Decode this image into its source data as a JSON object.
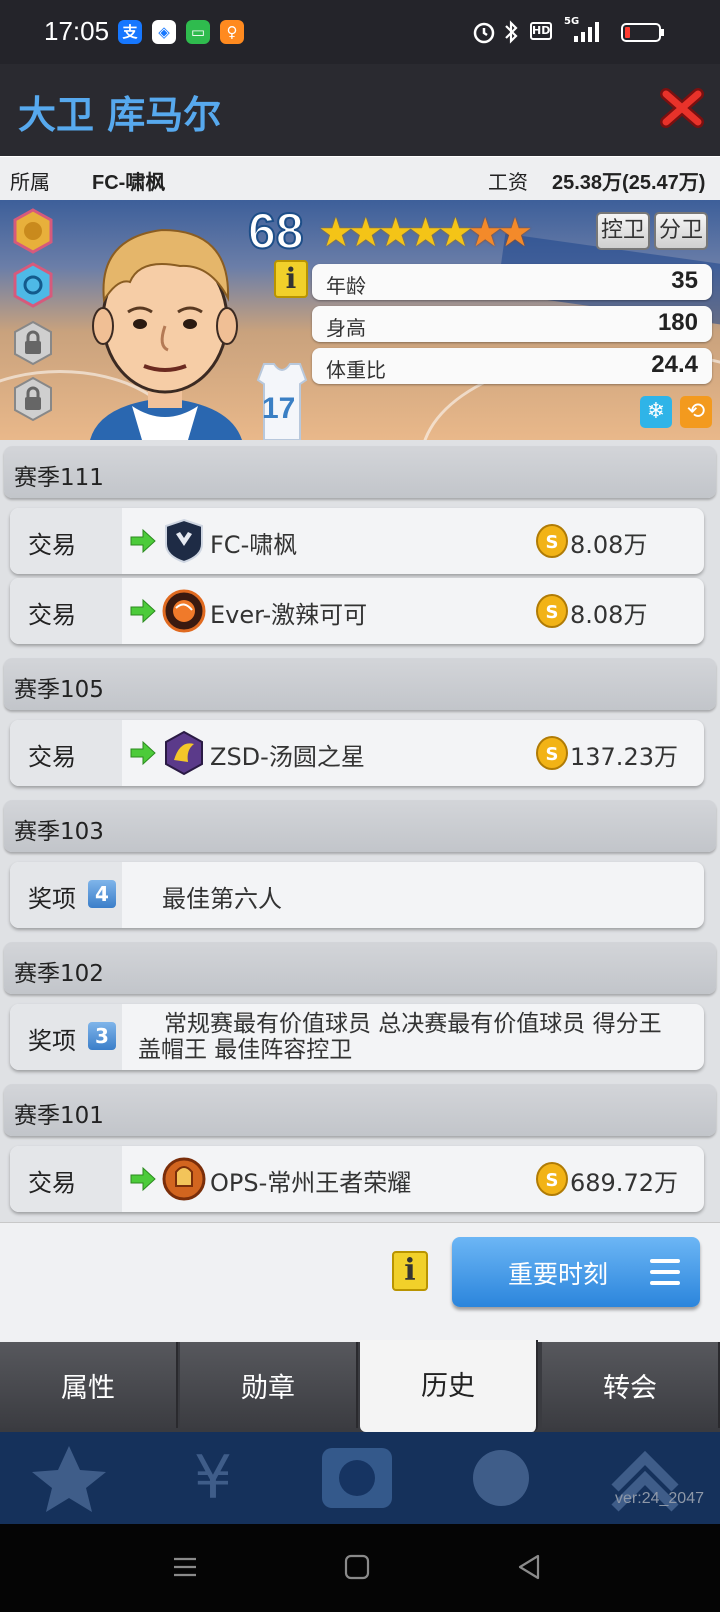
{
  "status_bar": {
    "time": "17:05",
    "apps": [
      "alipay-icon",
      "browser-icon",
      "wechat-icon",
      "ticket-app-icon"
    ],
    "hd": "HD",
    "network": "5G"
  },
  "header": {
    "player_name": "大卫 库马尔"
  },
  "club": {
    "label": "所属",
    "name": "FC-啸枫",
    "salary_label": "工资",
    "salary_value": "25.38万(25.47万)"
  },
  "card": {
    "rating": "68",
    "stars_full": 5,
    "stars_orange": 2,
    "positions": [
      "控卫",
      "分卫"
    ],
    "stats": [
      {
        "label": "年龄",
        "value": "35"
      },
      {
        "label": "身高",
        "value": "180"
      },
      {
        "label": "体重比",
        "value": "24.4"
      }
    ],
    "jersey_number": "17"
  },
  "history": [
    {
      "season": "赛季111",
      "entries": [
        {
          "type": "交易",
          "team": "FC-啸枫",
          "price": "8.08万",
          "logo_color": "#1e2b45"
        },
        {
          "type": "交易",
          "team": "Ever-激辣可可",
          "price": "8.08万",
          "logo_color": "#c5481f"
        }
      ]
    },
    {
      "season": "赛季105",
      "entries": [
        {
          "type": "交易",
          "team": "ZSD-汤圆之星",
          "price": "137.23万",
          "logo_color": "#5b3a8a"
        }
      ]
    },
    {
      "season": "赛季103",
      "entries": [
        {
          "type": "奖项",
          "count": "4",
          "text": "最佳第六人"
        }
      ]
    },
    {
      "season": "赛季102",
      "entries": [
        {
          "type": "奖项",
          "count": "3",
          "text": "常规赛最有价值球员 总决赛最有价值球员 得分王 盖帽王 最佳阵容控卫"
        }
      ]
    },
    {
      "season": "赛季101",
      "entries": [
        {
          "type": "交易",
          "team": "OPS-常州王者荣耀",
          "price": "689.72万",
          "logo_color": "#c2501e"
        }
      ]
    }
  ],
  "actions": {
    "info_label": "i",
    "moments_label": "重要时刻"
  },
  "tabs": [
    {
      "label": "属性",
      "active": false
    },
    {
      "label": "勋章",
      "active": false
    },
    {
      "label": "历史",
      "active": true
    },
    {
      "label": "转会",
      "active": false
    }
  ],
  "version": "ver:24_2047",
  "colors": {
    "title_blue": "#57a9ee",
    "button_blue": "#2b85dc",
    "coin_gold": "#f2b316"
  }
}
